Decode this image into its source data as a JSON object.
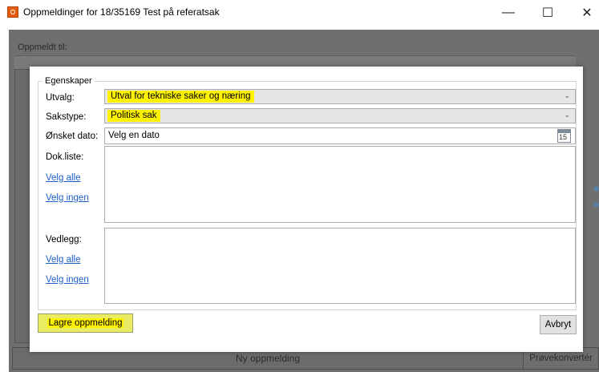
{
  "window": {
    "title": "Oppmeldinger for 18/35169 Test på referatsak",
    "minimize_glyph": "—",
    "maximize_glyph": "☐",
    "close_glyph": "✕",
    "icon": "app-o-icon"
  },
  "background": {
    "label": "Oppmeldt til:",
    "new_button": "Ny oppmelding",
    "convert_button": "Prøvekonvertér"
  },
  "dialog": {
    "group_title": "Egenskaper",
    "fields": {
      "utvalg_label": "Utvalg:",
      "utvalg_value": "Utval for tekniske saker og næring",
      "sakstype_label": "Sakstype:",
      "sakstype_value": "Politisk sak",
      "dato_label": "Ønsket dato:",
      "dato_placeholder": "Velg en dato",
      "calendar_day": "15"
    },
    "dokliste": {
      "label": "Dok.liste:",
      "select_all": "Velg alle",
      "select_none": "Velg ingen"
    },
    "vedlegg": {
      "label": "Vedlegg:",
      "select_all": "Velg alle",
      "select_none": "Velg ingen"
    },
    "save_button": "Lagre oppmelding",
    "cancel_button": "Avbryt"
  },
  "colors": {
    "highlight": "#fff200",
    "link": "#1c5fc7",
    "overlay": "#6f6f6f"
  }
}
